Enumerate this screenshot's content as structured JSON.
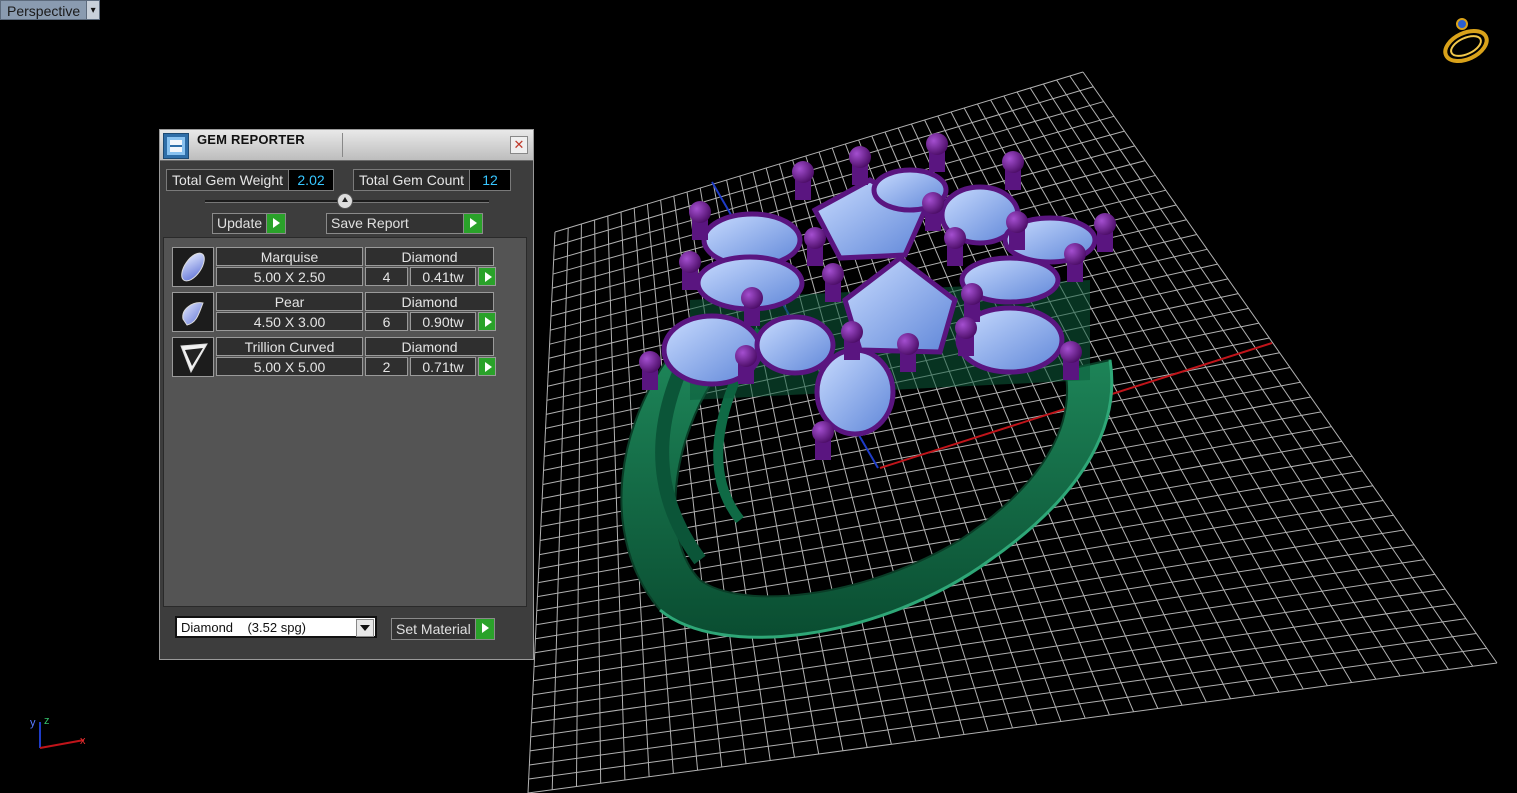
{
  "viewport": {
    "name": "Perspective",
    "axis_labels": [
      "y",
      "z",
      "x"
    ]
  },
  "panel": {
    "title": "GEM REPORTER",
    "close_glyph": "✕",
    "total_weight_label": "Total Gem Weight",
    "total_weight": "2.02",
    "total_count_label": "Total Gem Count",
    "total_count": "12",
    "update_label": "Update",
    "save_report_label": "Save Report",
    "gems": [
      {
        "shape": "Marquise",
        "material": "Diamond",
        "size": "5.00 X 2.50",
        "count": "4",
        "weight": "0.41tw",
        "icon": "marquise-gem-icon"
      },
      {
        "shape": "Pear",
        "material": "Diamond",
        "size": "4.50 X 3.00",
        "count": "6",
        "weight": "0.90tw",
        "icon": "pear-gem-icon"
      },
      {
        "shape": "Trillion Curved",
        "material": "Diamond",
        "size": "5.00 X 5.00",
        "count": "2",
        "weight": "0.71tw",
        "icon": "trillion-gem-icon"
      }
    ],
    "material_select": "Diamond    (3.52 spg)",
    "set_material_label": "Set Material"
  },
  "colors": {
    "grid": "#d8d8d8",
    "ring_metal": "#0f6a45",
    "prongs": "#6b1a8a",
    "gems": "#8fb4f0",
    "accent_green": "#2aa22a",
    "value_cyan": "#37c6ff"
  }
}
